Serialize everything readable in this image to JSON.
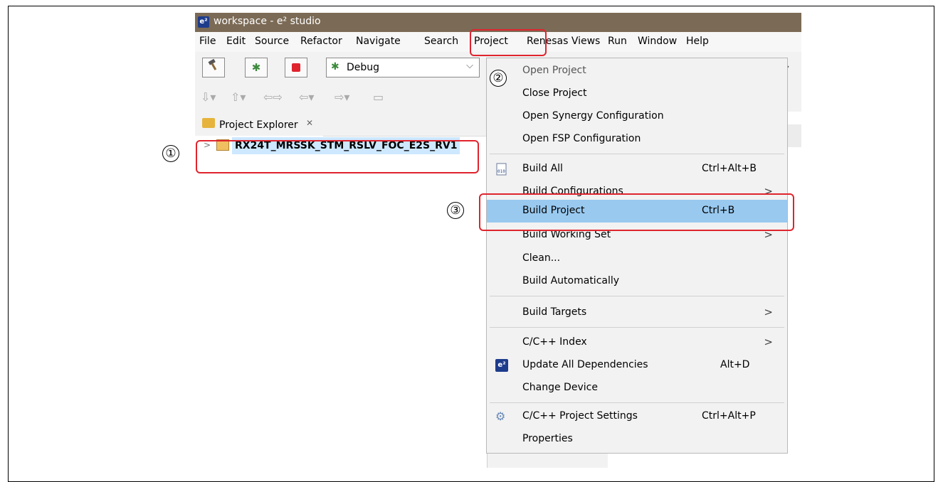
{
  "window": {
    "title": "workspace - e² studio",
    "app_icon_text": "e²"
  },
  "menubar": {
    "items": [
      "File",
      "Edit",
      "Source",
      "Refactor",
      "Navigate",
      "Search",
      "Project",
      "Renesas Views",
      "Run",
      "Window",
      "Help"
    ]
  },
  "toolbar": {
    "build_icon": "hammer-icon",
    "debug_icon": "bug-icon",
    "stop_icon": "stop-icon",
    "launch_config": "Debug"
  },
  "explorer": {
    "tab_label": "Project Explorer",
    "close_glyph": "✕",
    "project_name": "RX24T_MRSSK_STM_RSLV_FOC_E2S_RV1"
  },
  "annotations": {
    "step1": "①",
    "step2": "②",
    "step3": "③",
    "color": "#e0242e"
  },
  "project_menu": {
    "items": [
      {
        "label": "Open Project",
        "shortcut": "",
        "submenu": false,
        "icon": "",
        "disabled": true
      },
      {
        "label": "Close Project",
        "shortcut": "",
        "submenu": false,
        "icon": ""
      },
      {
        "label": "Open Synergy Configuration",
        "shortcut": "",
        "submenu": false,
        "icon": ""
      },
      {
        "label": "Open FSP Configuration",
        "shortcut": "",
        "submenu": false,
        "icon": ""
      },
      {
        "label": "Build All",
        "shortcut": "Ctrl+Alt+B",
        "submenu": false,
        "icon": "binary-file-icon"
      },
      {
        "label": "Build Configurations",
        "shortcut": "",
        "submenu": true,
        "icon": ""
      },
      {
        "label": "Build Project",
        "shortcut": "Ctrl+B",
        "submenu": false,
        "icon": "",
        "highlighted": true
      },
      {
        "label": "Build Working Set",
        "shortcut": "",
        "submenu": true,
        "icon": ""
      },
      {
        "label": "Clean...",
        "shortcut": "",
        "submenu": false,
        "icon": ""
      },
      {
        "label": "Build Automatically",
        "shortcut": "",
        "submenu": false,
        "icon": ""
      },
      {
        "label": "Build Targets",
        "shortcut": "",
        "submenu": true,
        "icon": ""
      },
      {
        "label": "C/C++ Index",
        "shortcut": "",
        "submenu": true,
        "icon": ""
      },
      {
        "label": "Update All Dependencies",
        "shortcut": "Alt+D",
        "submenu": false,
        "icon": "e2-icon"
      },
      {
        "label": "Change Device",
        "shortcut": "",
        "submenu": false,
        "icon": ""
      },
      {
        "label": "C/C++ Project Settings",
        "shortcut": "Ctrl+Alt+P",
        "submenu": false,
        "icon": "settings-icon"
      },
      {
        "label": "Properties",
        "shortcut": "",
        "submenu": false,
        "icon": ""
      }
    ],
    "submenu_glyph": ">"
  }
}
